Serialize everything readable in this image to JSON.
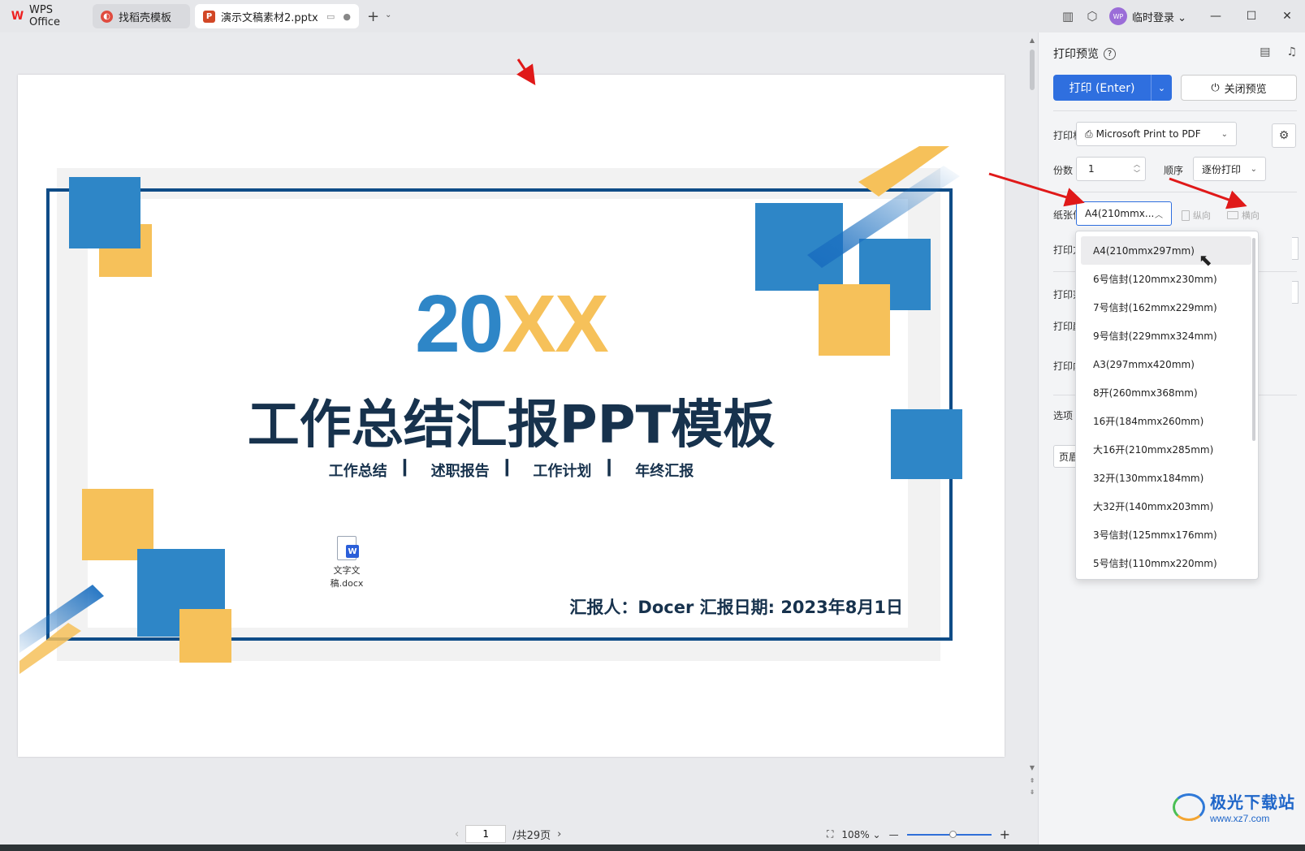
{
  "titlebar": {
    "tabs": [
      {
        "label": "WPS Office",
        "icon": "wps-logo-icon"
      },
      {
        "label": "找稻壳模板",
        "icon": "docer-icon"
      },
      {
        "label": "演示文稿素材2.pptx",
        "icon": "ppt-icon"
      }
    ],
    "new_tab_symbol": "+",
    "login_label": "临时登录",
    "avatar_text": "WP"
  },
  "slide": {
    "year_blue": "20",
    "year_yellow": "XX",
    "title": "工作总结汇报PPT模板",
    "subtitles": [
      "工作总结",
      "述职报告",
      "工作计划",
      "年终汇报"
    ],
    "separator": "▎",
    "footer": "汇报人：Docer  汇报日期: 2023年8月1日",
    "embedded_file": "文字文稿.docx",
    "embedded_file_badge": "W",
    "colors": {
      "blue": "#2e86c7",
      "yellow": "#f6c15a",
      "dark": "#17324d",
      "frame": "#0f4c87"
    }
  },
  "statusbar": {
    "page_value": "1",
    "page_total": "/共29页",
    "zoom": "108%",
    "zoom_fraction": 0.5
  },
  "panel": {
    "title": "打印预览",
    "print_label": "打印 (Enter)",
    "close_label": "关闭预览",
    "printer_label": "打印机",
    "printer_value": "Microsoft Print to PDF",
    "copies_label": "份数",
    "copies_value": "1",
    "order_label": "顺序",
    "order_value": "逐份打印",
    "paper_label": "纸张信息",
    "paper_value": "A4(210mmx...",
    "portrait_label": "纵向",
    "landscape_label": "横向",
    "print_mode_label": "打印方式",
    "print_range_label": "打印范围",
    "print_color_label": "打印颜色",
    "print_content_label": "打印内容",
    "options_label": "选项",
    "header_footer_label": "页眉页脚",
    "accent_color": "#2f6fdf"
  },
  "paper_options": [
    "A4(210mmx297mm)",
    "6号信封(120mmx230mm)",
    "7号信封(162mmx229mm)",
    "9号信封(229mmx324mm)",
    "A3(297mmx420mm)",
    "8开(260mmx368mm)",
    "16开(184mmx260mm)",
    "大16开(210mmx285mm)",
    "32开(130mmx184mm)",
    "大32开(140mmx203mm)",
    "3号信封(125mmx176mm)",
    "5号信封(110mmx220mm)"
  ],
  "watermark": {
    "site_name": "极光下载站",
    "url": "www.xz7.com"
  }
}
